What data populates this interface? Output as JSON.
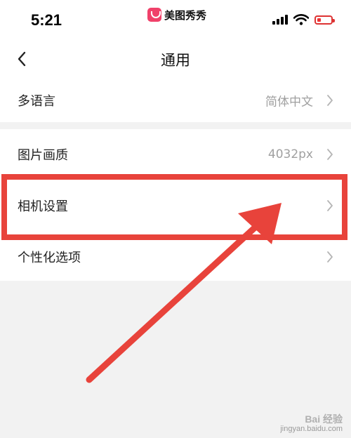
{
  "status_bar": {
    "time": "5:21",
    "app_name": "美图秀秀",
    "battery_level": 0.3,
    "icons": [
      "signal-icon",
      "wifi-icon",
      "battery-icon"
    ]
  },
  "nav": {
    "title": "通用",
    "back_icon": "back-chevron-icon"
  },
  "settings": {
    "language": {
      "label": "多语言",
      "value": "简体中文"
    },
    "image_quality": {
      "label": "图片画质",
      "value": "4032px"
    },
    "camera_settings": {
      "label": "相机设置"
    },
    "personalization": {
      "label": "个性化选项"
    }
  },
  "watermark": {
    "line1": "Bai 经验",
    "line2": "jingyan.baidu.com"
  },
  "colors": {
    "annotation": "#e8433b",
    "background": "#f2f2f2",
    "secondary_text": "#a0a0a0"
  }
}
